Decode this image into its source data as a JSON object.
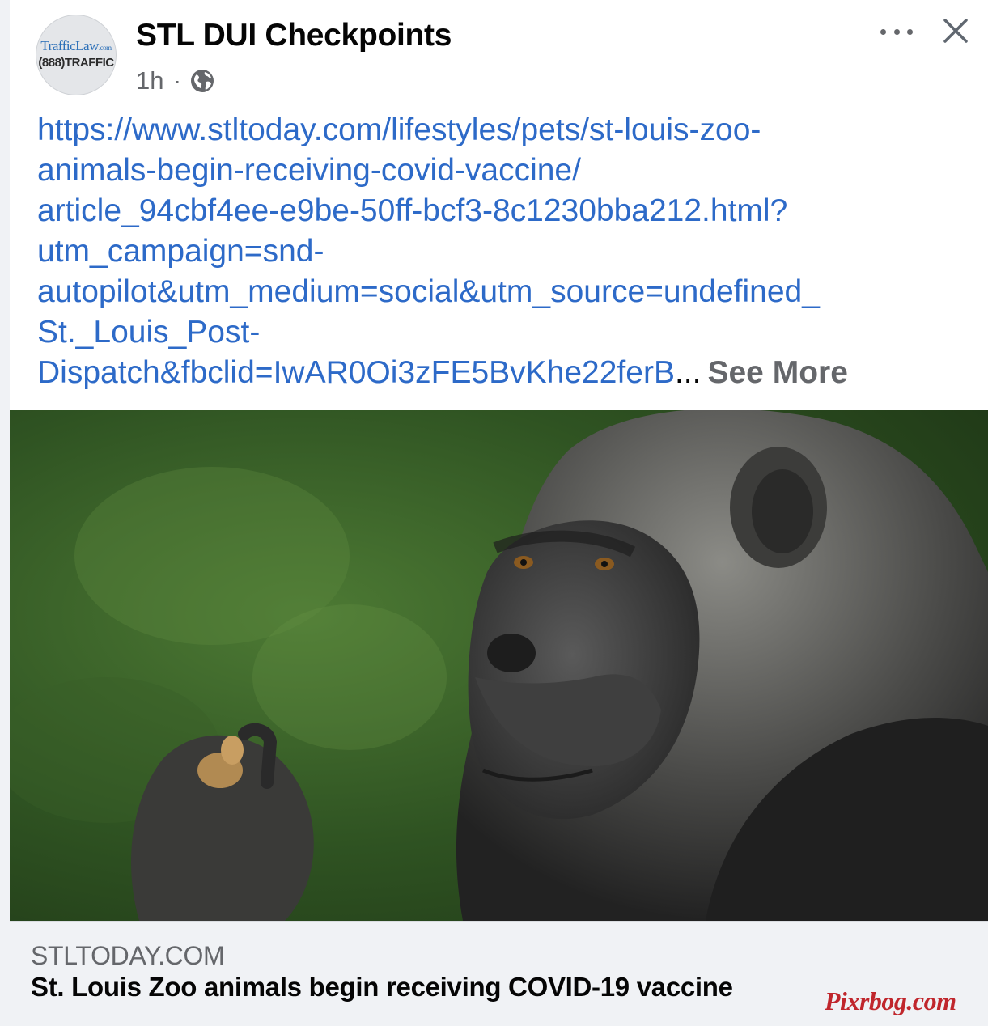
{
  "post": {
    "page_name": "STL DUI Checkpoints",
    "timestamp": "1h",
    "separator": "·",
    "audience_icon": "globe-icon",
    "avatar": {
      "brand_top": "TrafficLaw",
      "brand_top_suffix": ".com",
      "brand_bottom": "(888)TRAFFIC"
    },
    "text_lines": [
      "https://www.stltoday.com/lifestyles/pets/st-louis-zoo-",
      "animals-begin-receiving-covid-vaccine/",
      "article_94cbf4ee-e9be-50ff-bcf3-8c1230bba212.html?",
      "utm_campaign=snd-",
      "autopilot&utm_medium=social&utm_source=undefined_",
      "St._Louis_Post-",
      "Dispatch&fbclid=IwAR0Oi3zFE5BvKhe22ferB"
    ],
    "ellipsis": "...",
    "see_more": "See More"
  },
  "link_preview": {
    "domain": "STLTODAY.COM",
    "headline": "St. Louis Zoo animals begin receiving COVID-19 vaccine"
  },
  "watermark": "Pixrbog.com",
  "colors": {
    "link": "#2d6ac8",
    "secondary_text": "#65676b",
    "footer_bg": "#f0f2f5",
    "watermark": "#c0262c"
  }
}
